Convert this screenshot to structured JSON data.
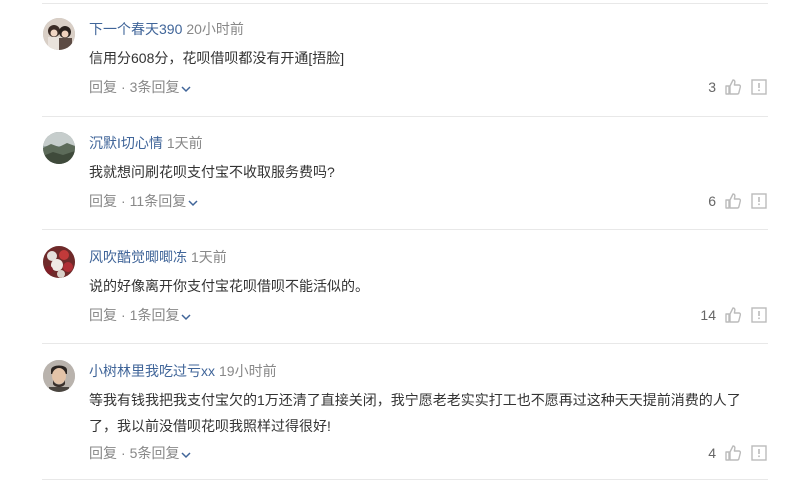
{
  "comments": [
    {
      "author": "下一个春天390",
      "time": "20小时前",
      "text": "信用分608分，花呗借呗都没有开通[捂脸]",
      "reply_label": "回复",
      "separator": "·",
      "replies_label": "3条回复",
      "likes": "3",
      "avatar": "avatar-couple"
    },
    {
      "author": "沉默I切心情",
      "time": "1天前",
      "text": "我就想问刷花呗支付宝不收取服务费吗?",
      "reply_label": "回复",
      "separator": "·",
      "replies_label": "11条回复",
      "likes": "6",
      "avatar": "avatar-landscape"
    },
    {
      "author": "风吹酷觉唧唧冻",
      "time": "1天前",
      "text": "说的好像离开你支付宝花呗借呗不能活似的。",
      "reply_label": "回复",
      "separator": "·",
      "replies_label": "1条回复",
      "likes": "14",
      "avatar": "avatar-flowers"
    },
    {
      "author": "小树林里我吃过亏xx",
      "time": "19小时前",
      "text": "等我有钱我把我支付宝欠的1万还清了直接关闭，我宁愿老老实实打工也不愿再过这种天天提前消费的人了了，我以前没借呗花呗我照样过得很好!",
      "reply_label": "回复",
      "separator": "·",
      "replies_label": "5条回复",
      "likes": "4",
      "avatar": "avatar-man"
    }
  ],
  "icons": {
    "like": "thumbs-up-icon",
    "report": "report-icon",
    "expand": "chevron-down-icon"
  },
  "colors": {
    "author": "#406599",
    "meta": "#888888",
    "text": "#333333",
    "icon": "#bbbbbb",
    "divider": "#e8e8e8"
  }
}
